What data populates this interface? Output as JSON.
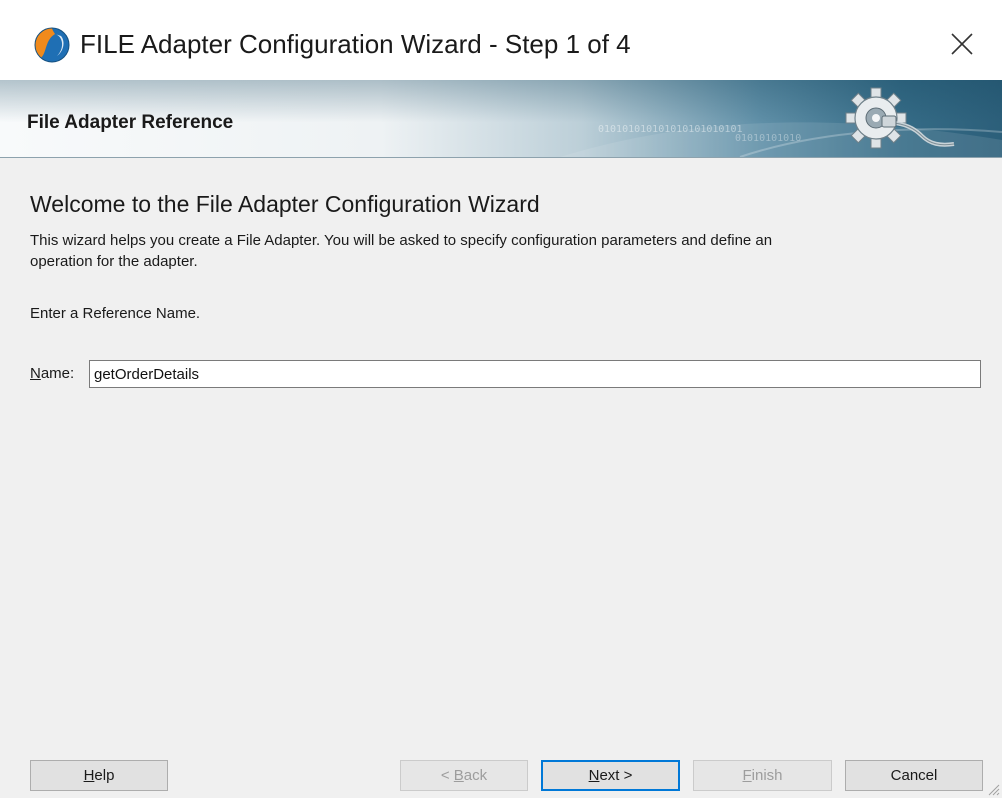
{
  "window": {
    "title": "FILE Adapter Configuration Wizard - Step 1 of 4"
  },
  "header": {
    "title": "File Adapter Reference",
    "binary_pattern": "010101010101010101010101",
    "binary_pattern_2": "01010101010"
  },
  "welcome": {
    "heading": "Welcome to the File Adapter Configuration Wizard",
    "description_lines": [
      "This wizard helps you create a File Adapter. You will be asked to specify configuration parameters and define an",
      "operation for the adapter."
    ],
    "prompt": "Enter a Reference Name."
  },
  "name_field": {
    "label": "Name:",
    "value": "getOrderDetails"
  },
  "buttons": {
    "help": "Help",
    "back": "< Back",
    "next": "Next >",
    "finish": "Finish",
    "cancel": "Cancel"
  },
  "states": {
    "back_enabled": false,
    "next_enabled": true,
    "finish_enabled": false,
    "default_button": "next"
  },
  "icons": {
    "app": "app-logo-icon",
    "close": "close-icon",
    "header_graphic": "gear-plug-icon",
    "resize": "resize-grip-icon"
  },
  "colors": {
    "accent": "#0078d7",
    "header_dark": "#2c5f7a",
    "content_bg": "#f0f0f0"
  }
}
